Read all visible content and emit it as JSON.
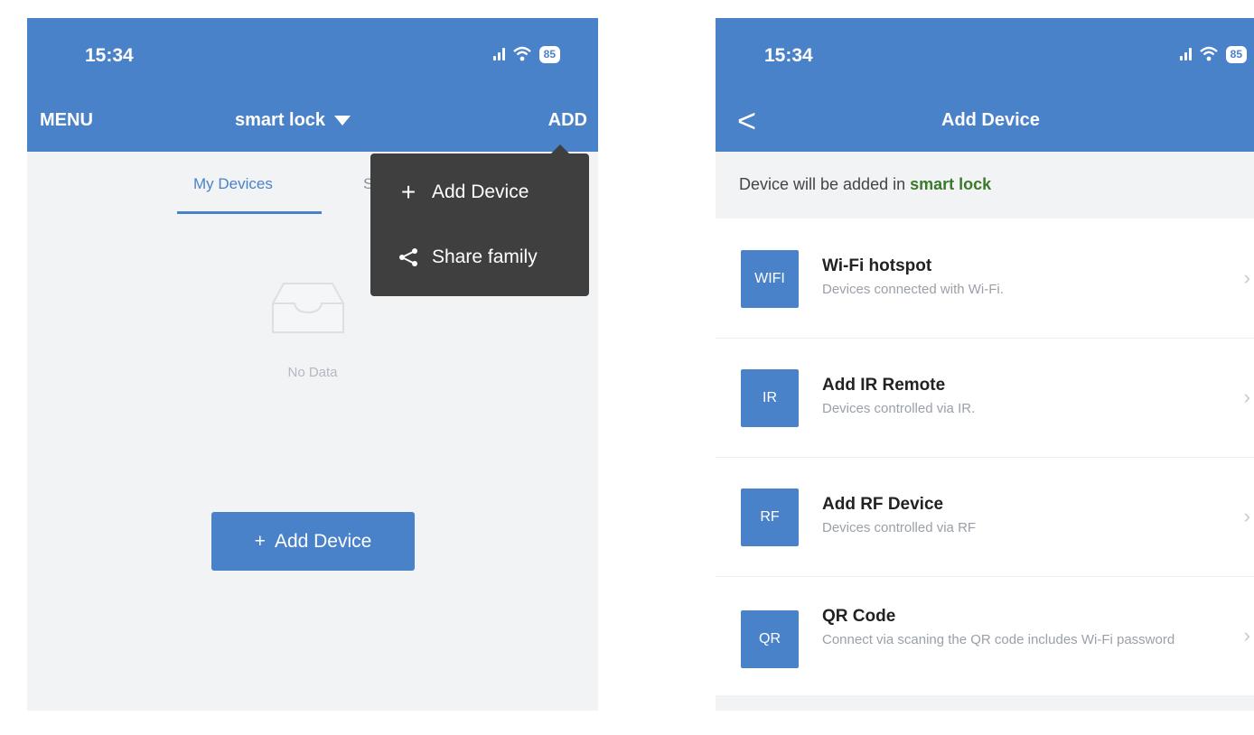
{
  "left": {
    "status": {
      "time": "15:34",
      "battery": "85"
    },
    "nav": {
      "menu_label": "MENU",
      "title": "smart lock",
      "add_label": "ADD"
    },
    "tabs": {
      "active": "My Devices",
      "other": "S"
    },
    "empty_text": "No Data",
    "add_button": {
      "icon": "+",
      "label": "Add Device"
    },
    "dropdown": [
      {
        "icon": "plus-icon",
        "glyph": "+",
        "label": "Add Device"
      },
      {
        "icon": "share-icon",
        "glyph": "<",
        "label": "Share family"
      }
    ]
  },
  "right": {
    "status": {
      "time": "15:34",
      "battery": "85"
    },
    "nav": {
      "back": "<",
      "title": "Add Device"
    },
    "info": {
      "prefix": "Device will be added in ",
      "family": "smart lock"
    },
    "options": [
      {
        "badge": "WIFI",
        "title": "Wi-Fi hotspot",
        "desc": "Devices connected with Wi-Fi."
      },
      {
        "badge": "IR",
        "title": "Add IR Remote",
        "desc": "Devices controlled via IR."
      },
      {
        "badge": "RF",
        "title": "Add RF Device",
        "desc": "Devices controlled via RF"
      },
      {
        "badge": "QR",
        "title": "QR Code",
        "desc": "Connect via scaning the QR code includes Wi-Fi password"
      }
    ]
  },
  "colors": {
    "header": "#4a82c9",
    "menu_bg": "#3f3f3f",
    "accent_green": "#3a7a2a"
  }
}
